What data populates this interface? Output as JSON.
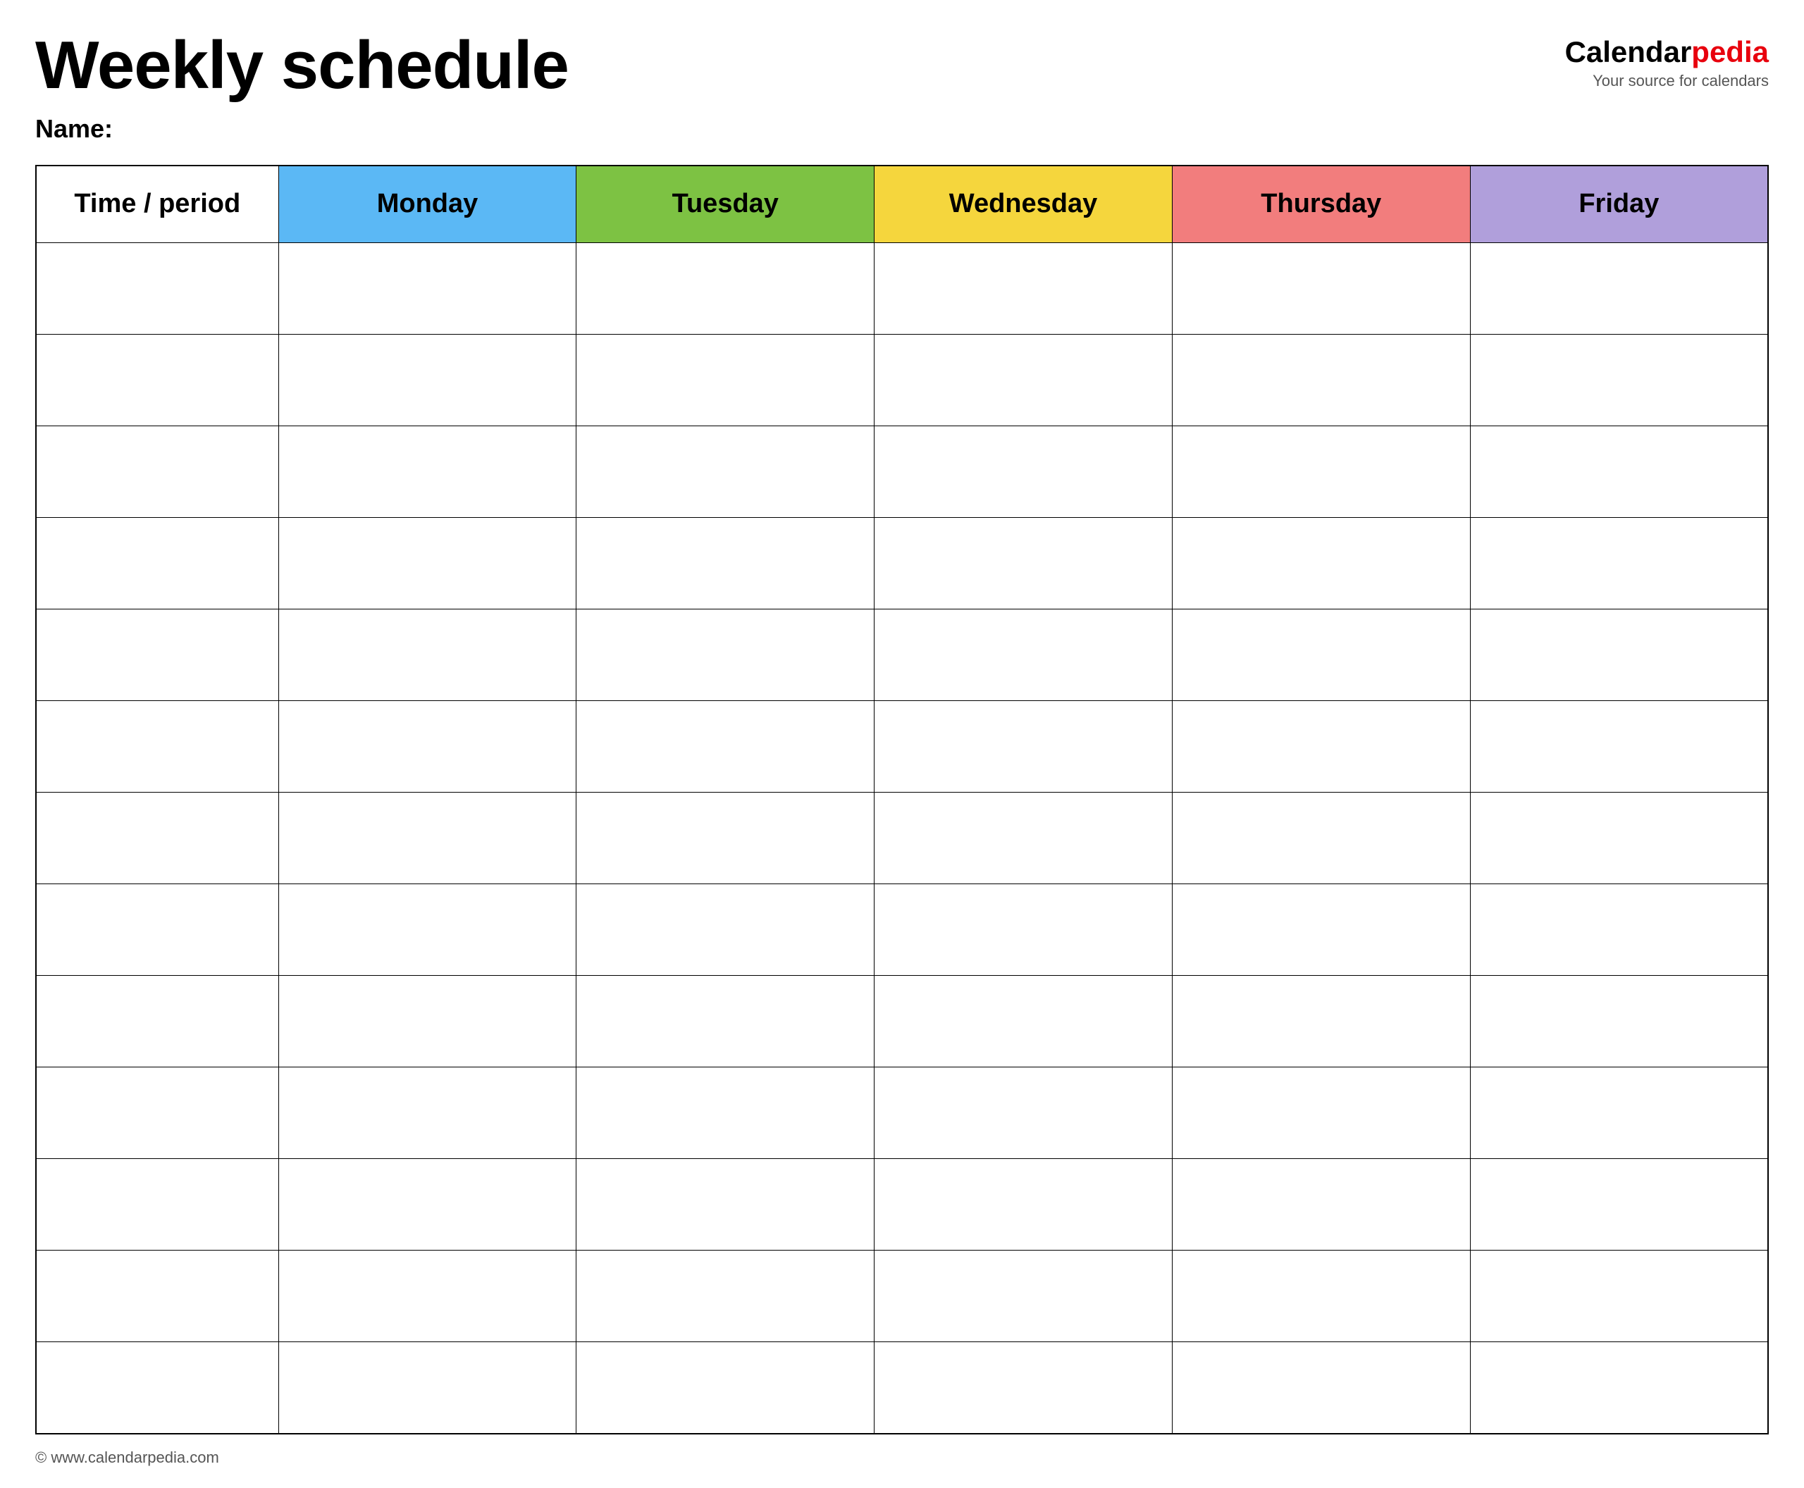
{
  "header": {
    "title": "Weekly schedule",
    "name_label": "Name:",
    "logo": {
      "calendar_text": "Calendar",
      "pedia_text": "pedia",
      "subtitle": "Your source for calendars"
    }
  },
  "table": {
    "columns": [
      {
        "id": "time",
        "label": "Time / period",
        "color": "#ffffff"
      },
      {
        "id": "monday",
        "label": "Monday",
        "color": "#5bb8f5"
      },
      {
        "id": "tuesday",
        "label": "Tuesday",
        "color": "#7dc243"
      },
      {
        "id": "wednesday",
        "label": "Wednesday",
        "color": "#f5d63d"
      },
      {
        "id": "thursday",
        "label": "Thursday",
        "color": "#f27d7d"
      },
      {
        "id": "friday",
        "label": "Friday",
        "color": "#b09fdb"
      }
    ],
    "row_count": 13
  },
  "footer": {
    "url": "© www.calendarpedia.com"
  }
}
